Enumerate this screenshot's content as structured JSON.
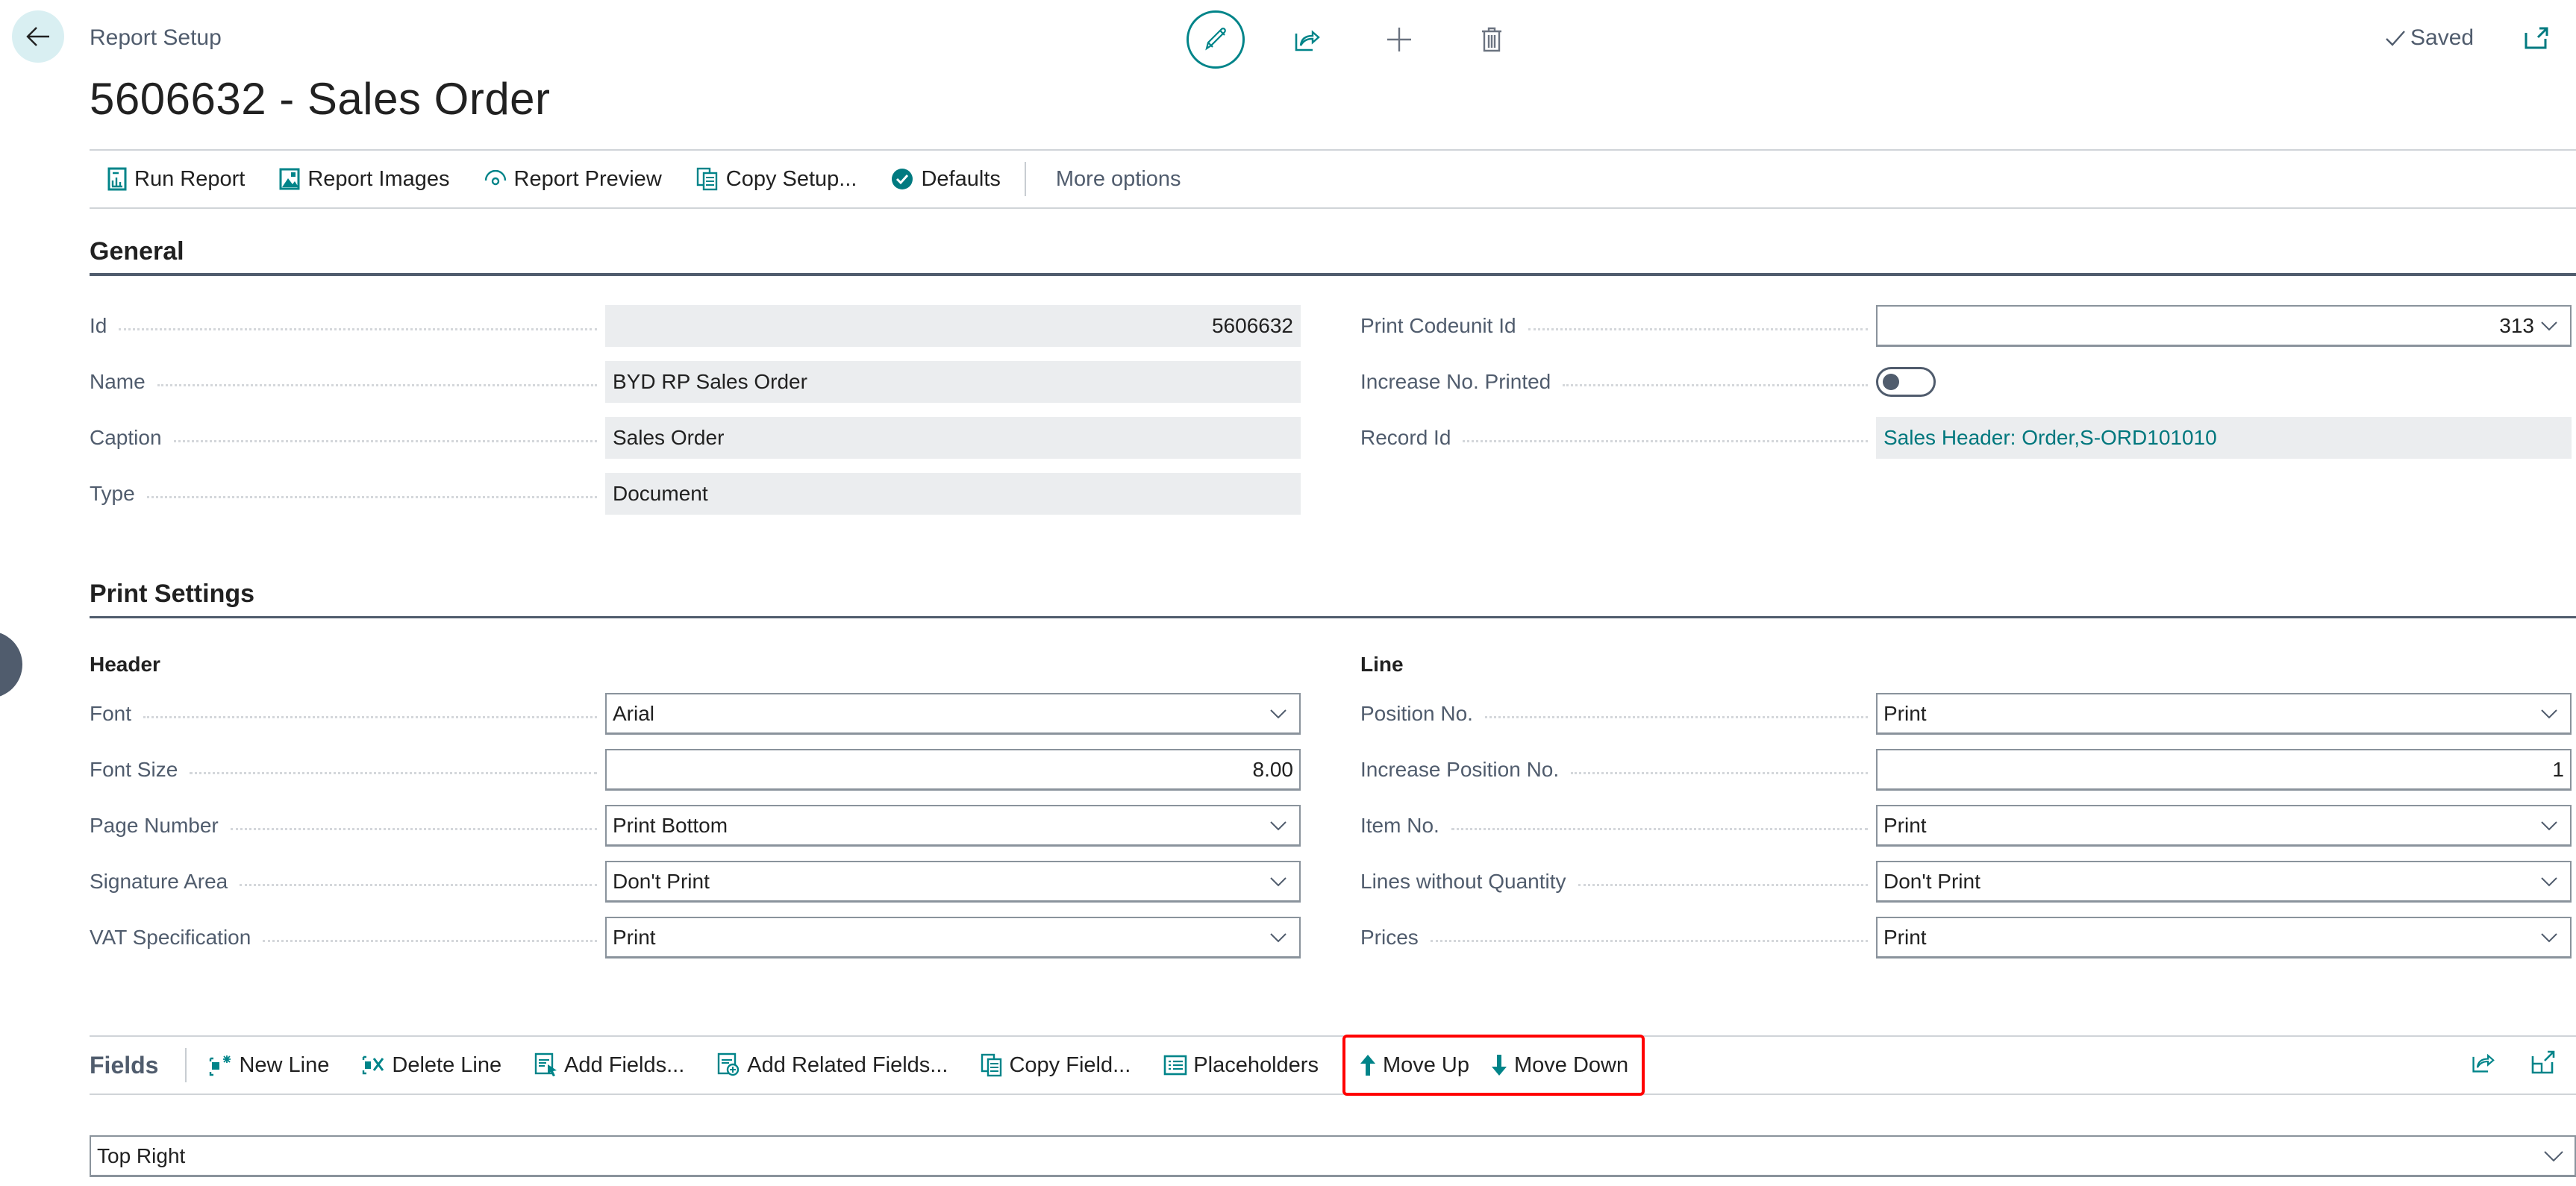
{
  "header": {
    "breadcrumb": "Report Setup",
    "title": "5606632 - Sales Order",
    "status": "Saved",
    "icons": {
      "back": "arrow-left-icon",
      "edit": "pencil-icon",
      "share": "share-icon",
      "new": "plus-icon",
      "delete": "trash-icon",
      "saved": "checkmark-icon",
      "popout": "open-new-window-icon"
    }
  },
  "actions": [
    {
      "label": "Run Report",
      "icon": "run-report-icon"
    },
    {
      "label": "Report Images",
      "icon": "image-icon"
    },
    {
      "label": "Report Preview",
      "icon": "preview-eye-icon"
    },
    {
      "label": "Copy Setup...",
      "icon": "copy-icon"
    },
    {
      "label": "Defaults",
      "icon": "check-circle-icon"
    }
  ],
  "more_options": "More options",
  "general": {
    "title": "General",
    "left": [
      {
        "label": "Id",
        "value": "5606632"
      },
      {
        "label": "Name",
        "value": "BYD RP Sales Order"
      },
      {
        "label": "Caption",
        "value": "Sales Order"
      },
      {
        "label": "Type",
        "value": "Document"
      }
    ],
    "right": [
      {
        "label": "Print Codeunit Id",
        "value": "313"
      },
      {
        "label": "Increase No. Printed",
        "value": false
      },
      {
        "label": "Record Id",
        "value": "Sales Header: Order,S-ORD101010"
      }
    ]
  },
  "print_settings": {
    "title": "Print Settings",
    "header_group": {
      "title": "Header",
      "fields": [
        {
          "label": "Font",
          "value": "Arial"
        },
        {
          "label": "Font Size",
          "value": "8.00"
        },
        {
          "label": "Page Number",
          "value": "Print Bottom"
        },
        {
          "label": "Signature Area",
          "value": "Don't Print"
        },
        {
          "label": "VAT Specification",
          "value": "Print"
        }
      ]
    },
    "line_group": {
      "title": "Line",
      "fields": [
        {
          "label": "Position No.",
          "value": "Print"
        },
        {
          "label": "Increase Position No.",
          "value": "1"
        },
        {
          "label": "Item No.",
          "value": "Print"
        },
        {
          "label": "Lines without Quantity",
          "value": "Don't Print"
        },
        {
          "label": "Prices",
          "value": "Print"
        }
      ]
    }
  },
  "fields_part": {
    "title": "Fields",
    "actions": [
      {
        "label": "New Line",
        "icon": "new-line-icon"
      },
      {
        "label": "Delete Line",
        "icon": "delete-line-icon"
      },
      {
        "label": "Add Fields...",
        "icon": "add-fields-icon"
      },
      {
        "label": "Add Related Fields...",
        "icon": "add-related-fields-icon"
      },
      {
        "label": "Copy Field...",
        "icon": "copy-icon"
      },
      {
        "label": "Placeholders",
        "icon": "list-icon"
      },
      {
        "label": "Move Up",
        "icon": "arrow-up-icon"
      },
      {
        "label": "Move Down",
        "icon": "arrow-down-icon"
      }
    ],
    "position_value": "Top Right"
  },
  "colors": {
    "accent": "#008489",
    "highlight": "#ff0000",
    "text_muted": "#505c6d"
  }
}
